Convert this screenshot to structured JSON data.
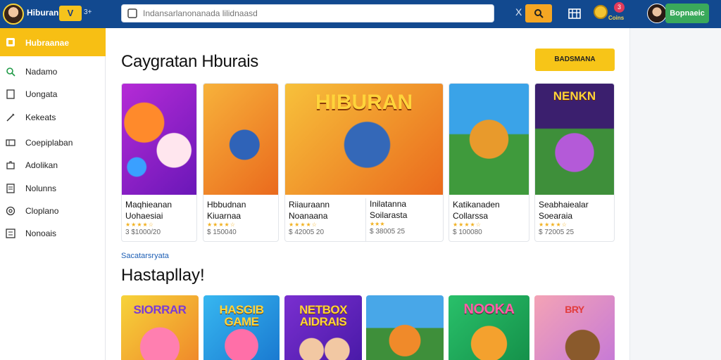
{
  "header": {
    "brand": "Hiburan",
    "brand_badge": "V",
    "brand_extra": "3+",
    "search_placeholder": "Indansarlanonanada lilidnaasd",
    "clear_label": "X",
    "notification_count": "3",
    "coins_label": "Coins",
    "profile_button": "Bopnaeic"
  },
  "sidebar": {
    "items": [
      {
        "label": "Hubraanae",
        "icon": "home-icon",
        "active": true
      },
      {
        "label": "Nadamo",
        "icon": "search-icon"
      },
      {
        "label": "Uongata",
        "icon": "bookmark-icon"
      },
      {
        "label": "Kekeats",
        "icon": "pen-icon"
      },
      {
        "label": "Coepiplaban",
        "icon": "ticket-icon"
      },
      {
        "label": "Adolikan",
        "icon": "puzzle-icon"
      },
      {
        "label": "Nolunns",
        "icon": "note-icon"
      },
      {
        "label": "Cloplano",
        "icon": "globe-icon"
      },
      {
        "label": "Nonoais",
        "icon": "list-icon"
      }
    ]
  },
  "main": {
    "section_title": "Caygratan Hburais",
    "cta_label": "BADSMANA",
    "cards": [
      {
        "title1": "Maqhieanan",
        "title2": "Uohaesiai",
        "meta": "3 $1000/20",
        "thumb_text": ""
      },
      {
        "title1": "Hbbudnan",
        "title2": "Kiuarnaa",
        "meta": "$ 150040",
        "thumb_text": "HIBURAN"
      },
      {
        "title1": "Riiauraann",
        "title2": "Noanaana",
        "meta": "$ 42005 20",
        "thumb_text": ""
      },
      {
        "title1": "Inilatanna",
        "title2": "Soilarasta",
        "meta": "$ 38005 25",
        "thumb_text": ""
      },
      {
        "title1": "Katikanaden",
        "title2": "Collarssa",
        "meta": "$ 100080",
        "thumb_text": ""
      },
      {
        "title1": "Seabhaiealar",
        "title2": "Soearaia",
        "meta": "$ 72005 25",
        "thumb_text": "NENKN"
      }
    ],
    "sub_label": "Sacatarsryata",
    "section_title_2": "Hastapllay!",
    "tiles": [
      {
        "text": "SIORRAR"
      },
      {
        "text": "HASGIB GAME"
      },
      {
        "text": "NETBOX AIDRAIS"
      },
      {
        "text": ""
      },
      {
        "text": "NOOKA"
      },
      {
        "text": "BRY"
      }
    ]
  }
}
